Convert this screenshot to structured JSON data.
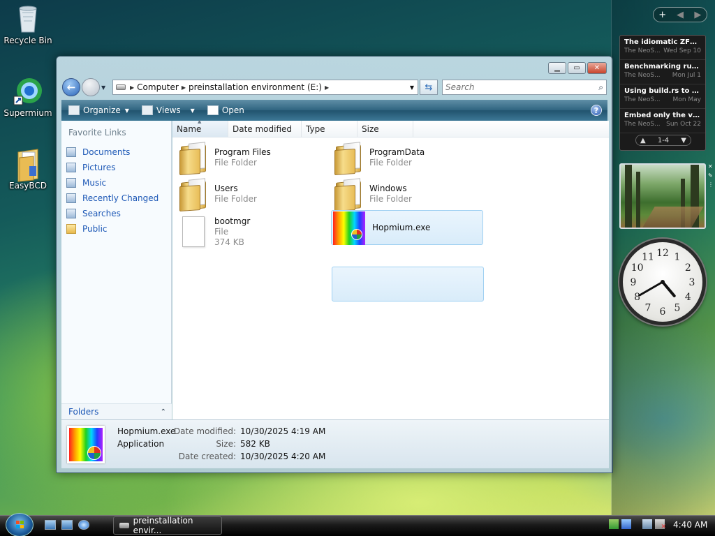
{
  "desktop": {
    "icons": [
      {
        "label": "Recycle Bin"
      },
      {
        "label": "Supermium"
      },
      {
        "label": "EasyBCD"
      }
    ]
  },
  "window": {
    "address": {
      "crumbs": [
        "Computer",
        "preinstallation environment (E:)"
      ]
    },
    "search": {
      "placeholder": "Search"
    },
    "toolbar": {
      "organize": "Organize",
      "views": "Views",
      "open": "Open"
    },
    "favorite_links": {
      "title": "Favorite Links",
      "items": [
        {
          "label": "Documents",
          "icon": "documents-icon"
        },
        {
          "label": "Pictures",
          "icon": "pictures-icon"
        },
        {
          "label": "Music",
          "icon": "music-icon"
        },
        {
          "label": "Recently Changed",
          "icon": "recent-icon"
        },
        {
          "label": "Searches",
          "icon": "searches-icon"
        },
        {
          "label": "Public",
          "icon": "folder-icon"
        }
      ],
      "folders_label": "Folders"
    },
    "columns": [
      "Name",
      "Date modified",
      "Type",
      "Size"
    ],
    "files": [
      {
        "name": "Program Files",
        "type": "File Folder"
      },
      {
        "name": "ProgramData",
        "type": "File Folder"
      },
      {
        "name": "Users",
        "type": "File Folder"
      },
      {
        "name": "Windows",
        "type": "File Folder"
      },
      {
        "name": "bootmgr",
        "type": "File",
        "size": "374 KB"
      },
      {
        "name": "Hopmium.exe",
        "selected": true
      }
    ],
    "details": {
      "name": "Hopmium.exe",
      "type": "Application",
      "date_modified_label": "Date modified:",
      "date_modified": "10/30/2025 4:19 AM",
      "size_label": "Size:",
      "size": "582 KB",
      "date_created_label": "Date created:",
      "date_created": "10/30/2025 4:20 AM"
    }
  },
  "sidebar": {
    "top_plus": "+",
    "feed": [
      {
        "title": "The idiomatic ZFS on...",
        "source": "The NeoS...",
        "date": "Wed Sep 10"
      },
      {
        "title": "Benchmarking rust c...",
        "source": "The NeoS...",
        "date": "Mon Jul 1"
      },
      {
        "title": "Using build.rs to inte...",
        "source": "The NeoS...",
        "date": "Mon May"
      },
      {
        "title": "Embed only the vide...",
        "source": "The NeoS...",
        "date": "Sun Oct 22"
      }
    ],
    "feed_page": "1-4",
    "clock_numbers": [
      "12",
      "1",
      "2",
      "3",
      "4",
      "5",
      "6",
      "7",
      "8",
      "9",
      "10",
      "11"
    ],
    "clock_time": {
      "hour": 4,
      "minute": 40
    }
  },
  "taskbar": {
    "task": "preinstallation envir...",
    "time": "4:40 AM"
  },
  "colors": {
    "link": "#1d58b6",
    "toolbar": "#2f6480",
    "selection": "#d9ecfa"
  }
}
